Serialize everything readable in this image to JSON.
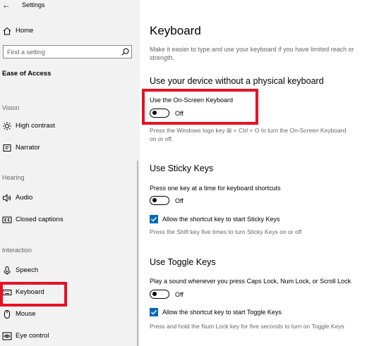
{
  "window": {
    "title": "Settings"
  },
  "sidebar": {
    "home_label": "Home",
    "search": {
      "placeholder": "Find a setting"
    },
    "section_title": "Ease of Access",
    "groups": {
      "vision": "Vision",
      "hearing": "Hearing",
      "interaction": "Interaction"
    },
    "items": {
      "high_contrast": "High contrast",
      "narrator": "Narrator",
      "audio": "Audio",
      "closed_captions": "Closed captions",
      "speech": "Speech",
      "keyboard": "Keyboard",
      "mouse": "Mouse",
      "eye_control": "Eye control"
    },
    "selected_item": "keyboard"
  },
  "main": {
    "title": "Keyboard",
    "description": "Make it easier to type and use your keyboard if you have limited reach or strength.",
    "osk": {
      "heading": "Use your device without a physical keyboard",
      "label": "Use the On-Screen Keyboard",
      "state": "Off",
      "hint": "Press the Windows logo key ⊞ + Ctrl + O to turn the On-Screen Keyboard on or off."
    },
    "sticky": {
      "heading": "Use Sticky Keys",
      "label": "Press one key at a time for keyboard shortcuts",
      "state": "Off",
      "checkbox_label": "Allow the shortcut key to start Sticky Keys",
      "checked": true,
      "hint": "Press the Shift key five times to turn Sticky Keys on or off"
    },
    "toggle_keys": {
      "heading": "Use Toggle Keys",
      "label": "Play a sound whenever you press Caps Lock, Num Lock, or Scroll Lock",
      "state": "Off",
      "checkbox_label": "Allow the shortcut key to start Toggle Keys",
      "checked": true,
      "hint": "Press and hold the Num Lock key for five seconds to turn on Toggle Keys"
    }
  },
  "colors": {
    "highlight": "#e81123",
    "accent": "#0067c0",
    "sidebar_bg": "#f2f2f2"
  },
  "icons": {
    "back": "back-arrow-icon",
    "home": "home-icon",
    "search": "search-icon",
    "high_contrast": "brightness-icon",
    "narrator": "narrator-icon",
    "audio": "speaker-icon",
    "closed_captions": "cc-icon",
    "speech": "microphone-icon",
    "keyboard": "keyboard-icon",
    "mouse": "mouse-icon",
    "eye_control": "eye-icon"
  }
}
